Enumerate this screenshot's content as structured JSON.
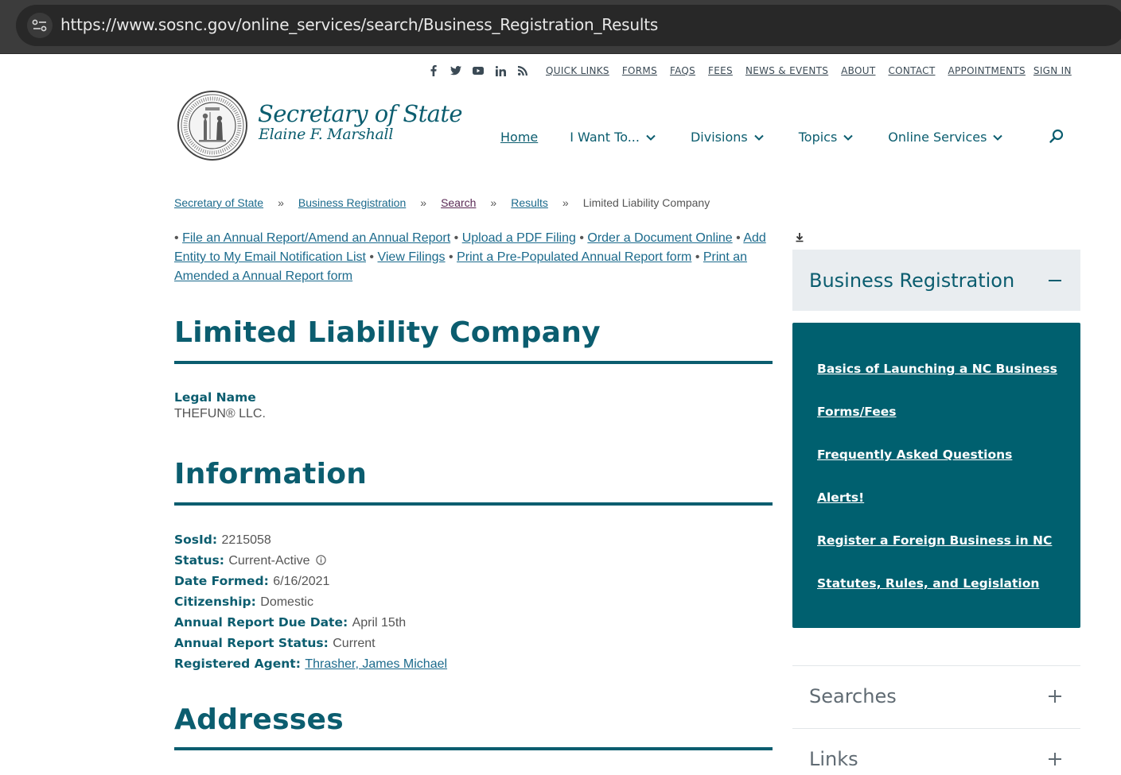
{
  "browser": {
    "url": "https://www.sosnc.gov/online_services/search/Business_Registration_Results"
  },
  "utility_nav": {
    "social_icons": [
      "facebook-icon",
      "twitter-icon",
      "youtube-icon",
      "linkedin-icon",
      "rss-icon"
    ],
    "links": [
      "QUICK LINKS",
      "FORMS",
      "FAQS",
      "FEES",
      "NEWS & EVENTS",
      "ABOUT",
      "CONTACT",
      "APPOINTMENTS",
      "SIGN IN"
    ]
  },
  "logo": {
    "title": "Secretary of State",
    "subtitle": "Elaine F. Marshall"
  },
  "main_nav": {
    "home": "Home",
    "i_want_to": "I Want To...",
    "divisions": "Divisions",
    "topics": "Topics",
    "online_services": "Online Services"
  },
  "breadcrumb": {
    "items": [
      "Secretary of State",
      "Business Registration",
      "Search",
      "Results"
    ],
    "separator": "»",
    "current": "Limited Liability Company"
  },
  "actions": {
    "bullet": "•",
    "links": [
      "File an Annual Report/Amend an Annual Report",
      "Upload a PDF Filing",
      "Order a Document Online",
      "Add Entity to My Email Notification List",
      "View Filings",
      "Print a Pre-Populated Annual Report form",
      "Print an Amended a Annual Report form"
    ]
  },
  "entity": {
    "heading": "Limited Liability Company",
    "legal_name_label": "Legal Name",
    "legal_name": "THEFUN® LLC."
  },
  "information": {
    "heading": "Information",
    "fields": [
      {
        "label": "SosId",
        "value": "2215058"
      },
      {
        "label": "Status",
        "value": "Current-Active"
      },
      {
        "label": "Date Formed",
        "value": "6/16/2021"
      },
      {
        "label": "Citizenship",
        "value": "Domestic"
      },
      {
        "label": "Annual Report Due Date",
        "value": "April 15th"
      },
      {
        "label": "Annual Report Status",
        "value": "Current"
      },
      {
        "label": "Registered Agent",
        "value": "Thrasher, James Michael"
      }
    ]
  },
  "addresses": {
    "heading": "Addresses"
  },
  "sidebar": {
    "title": "Business Registration",
    "links": [
      "Basics of Launching a NC Business",
      "Forms/Fees",
      "Frequently Asked Questions",
      "Alerts!",
      "Register a Foreign Business in NC",
      "Statutes, Rules, and Legislation"
    ],
    "accordions": [
      "Searches",
      "Links"
    ]
  },
  "colors": {
    "brand": "#0b5d6f",
    "panel": "#00606f",
    "link": "#1b6a8c"
  }
}
